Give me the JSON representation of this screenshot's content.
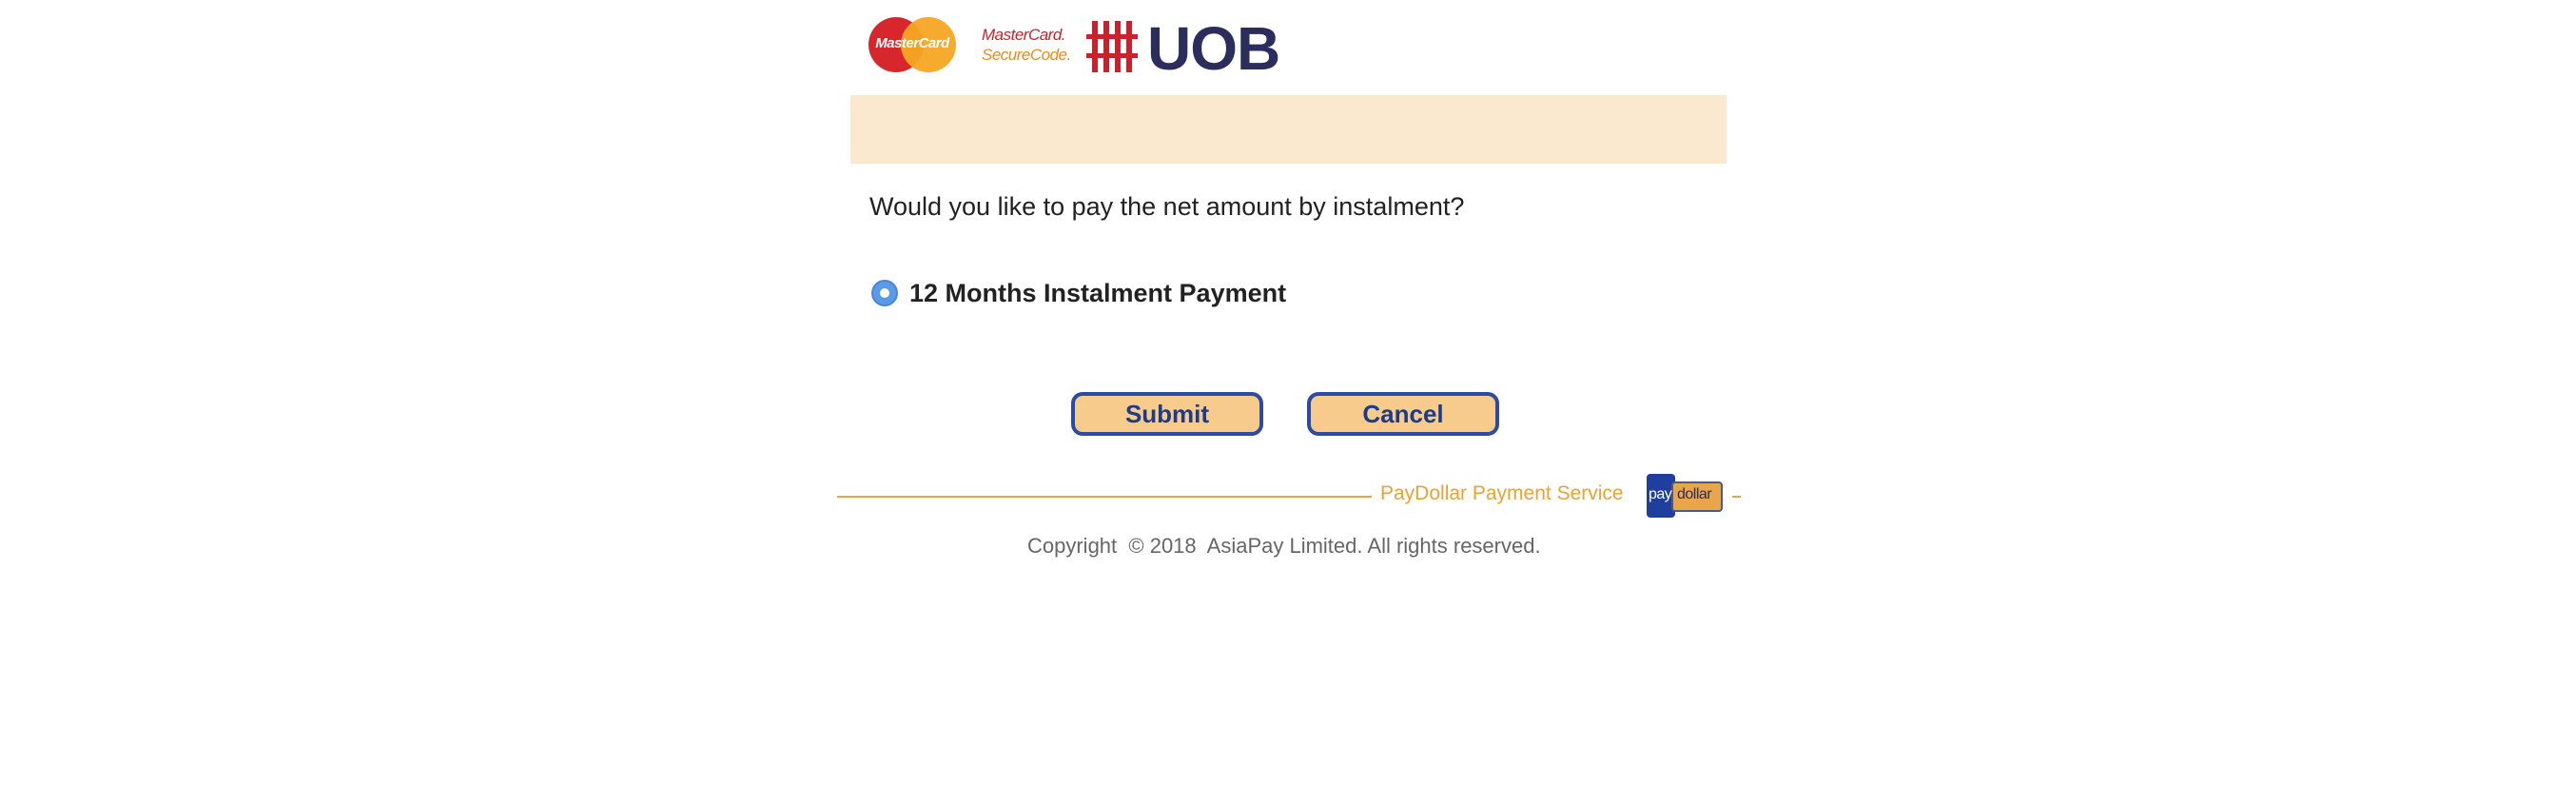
{
  "header": {
    "mastercard_logo_text": "MasterCard",
    "securecode_line1": "MasterCard.",
    "securecode_line2": "SecureCode.",
    "bank_logo_text": "UOB"
  },
  "form": {
    "question": "Would you like to pay the net amount by instalment?",
    "options": [
      {
        "label": "12 Months Instalment Payment",
        "selected": true
      }
    ],
    "submit_label": "Submit",
    "cancel_label": "Cancel"
  },
  "footer": {
    "service_text": "PayDollar Payment Service",
    "paydollar_logo_pay": "pay",
    "paydollar_logo_dollar": "dollar",
    "copyright": "Copyright  © 2018  AsiaPay Limited. All rights reserved."
  },
  "colors": {
    "banner": "#fbe9cf",
    "button_fill": "#f7cb8c",
    "button_border": "#2a4da3",
    "footer_accent": "#f0a033",
    "radio": "#5b9ae8"
  },
  "icons": {
    "mastercard": "mastercard-logo-icon",
    "securecode": "securecode-logo-icon",
    "uob": "uob-logo-icon",
    "paydollar": "paydollar-logo-icon"
  }
}
